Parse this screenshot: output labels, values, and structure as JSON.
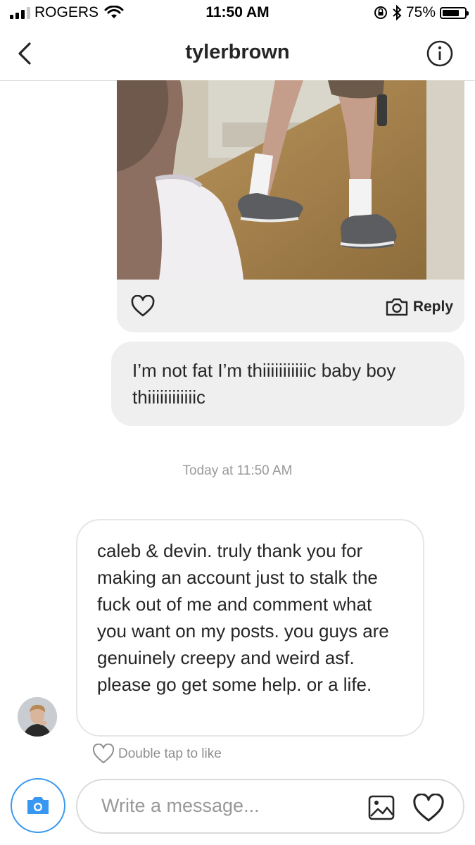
{
  "status_bar": {
    "carrier": "ROGERS",
    "time": "11:50 AM",
    "battery_text": "75%",
    "battery_level": 0.75,
    "signal_bars": 3
  },
  "header": {
    "username": "tylerbrown",
    "back_icon": "chevron-left-icon",
    "info_icon": "info-icon"
  },
  "shared_post": {
    "reply_label": "Reply",
    "like_icon": "heart-outline-icon",
    "camera_icon": "camera-icon"
  },
  "messages": {
    "sent_text": "I’m not fat  I’m thiiiiiiiiiiic baby boy thiiiiiiiiiiiic",
    "timestamp": "Today at 11:50 AM",
    "received_text": "caleb & devin. truly thank you for making an account just to stalk the fuck out of me and comment what you want on my posts. you guys are genuinely creepy and weird asf. please go get some help. or a life.",
    "double_tap_label": "Double tap to like"
  },
  "composer": {
    "placeholder": "Write a message...",
    "accent_color": "#3897f0"
  }
}
